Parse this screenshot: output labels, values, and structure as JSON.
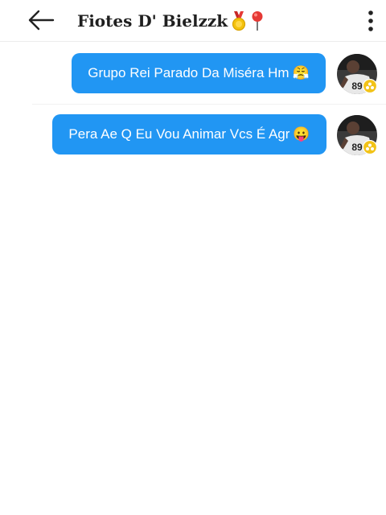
{
  "header": {
    "title": "Fiotes D' Bielzzk",
    "icons": [
      "back-arrow-icon",
      "medal-icon",
      "pin-icon",
      "more-vertical-icon"
    ]
  },
  "messages": [
    {
      "text": "Grupo Rei Parado Da Miséra Hm",
      "emoji": "😤",
      "emoji_name": "huffing-face-emoji"
    },
    {
      "text": "Pera Ae Q Eu Vou Animar Vcs É Agr",
      "emoji": "😛",
      "emoji_name": "tongue-face-emoji"
    }
  ],
  "avatar": {
    "jersey_number": "89"
  },
  "colors": {
    "bubble": "#2196f3",
    "bubble_text": "#ffffff",
    "title": "#1f1f1f",
    "badge": "#f2c318",
    "background": "#ffffff"
  }
}
